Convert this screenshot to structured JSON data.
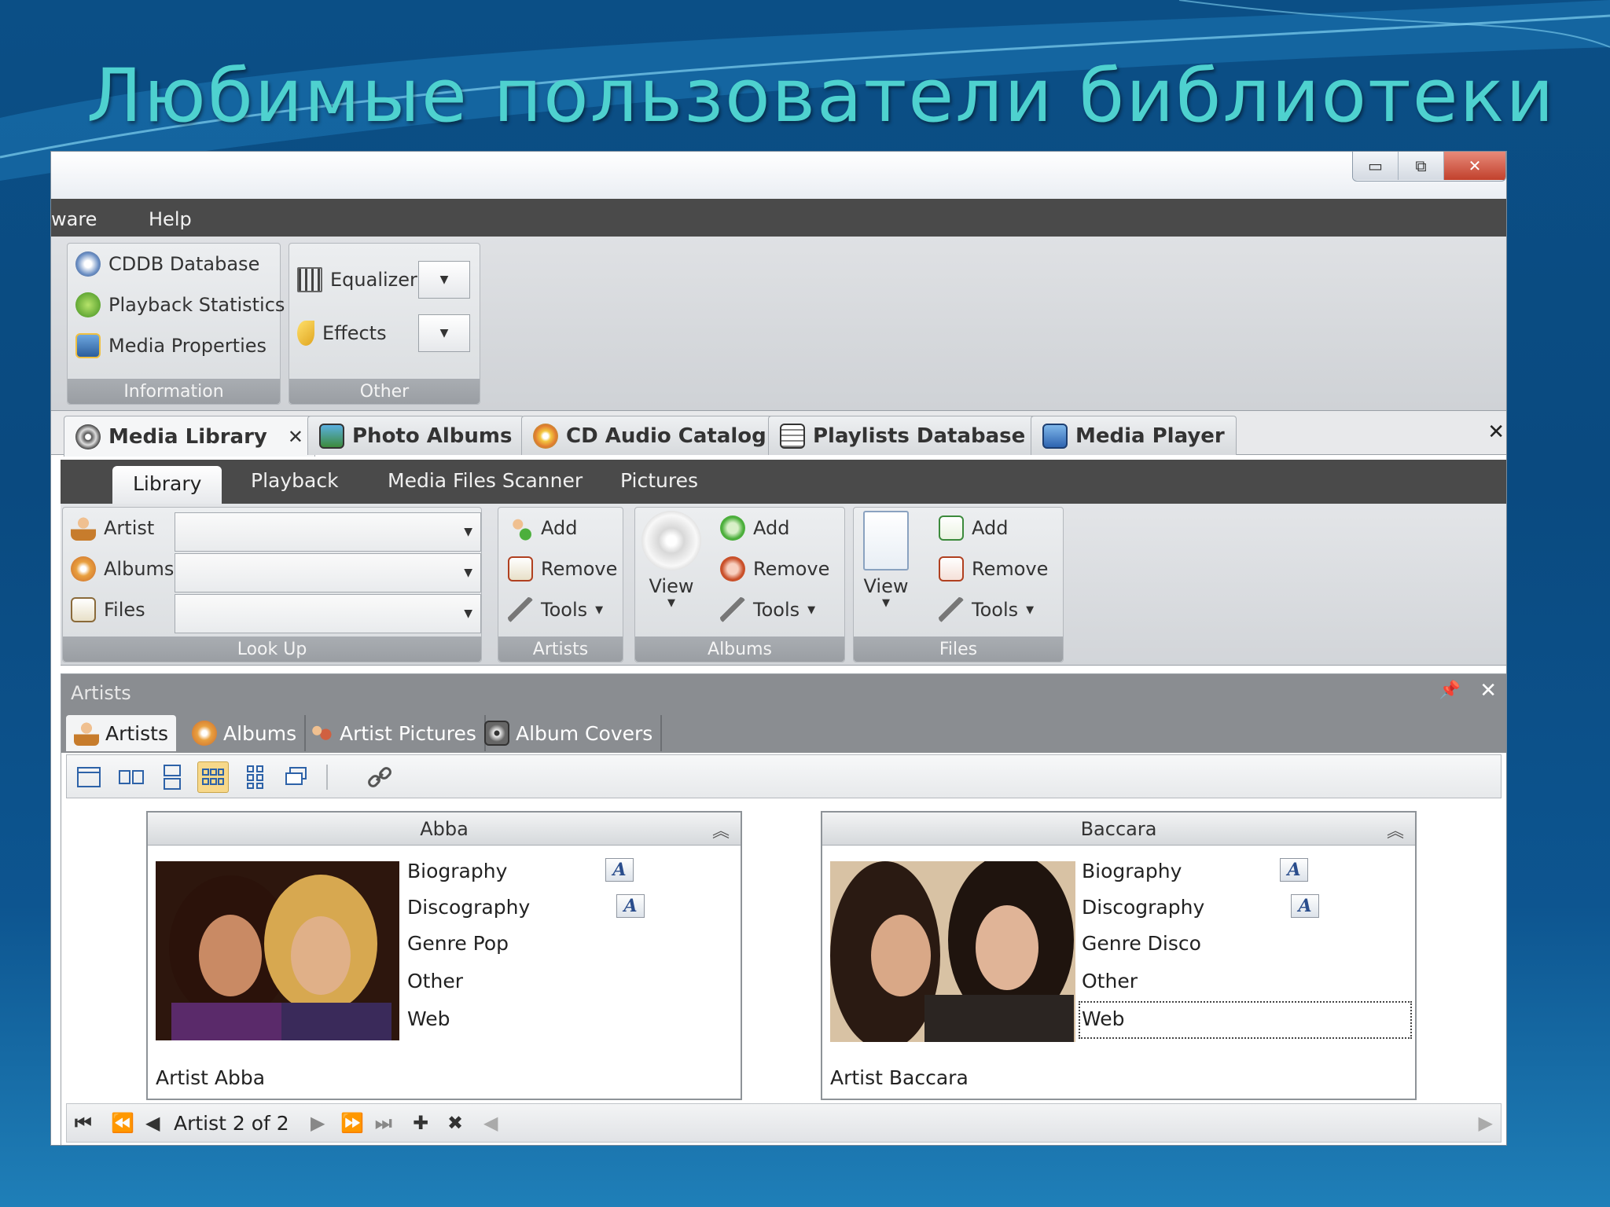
{
  "slide": {
    "title": "Любимые пользователи библиотеки"
  },
  "window": {
    "controls": {
      "minimize": "▭",
      "maximize": "⧉",
      "close": "✕"
    }
  },
  "menu": {
    "items": [
      "ware",
      "Help"
    ]
  },
  "ribbon_top": {
    "information": {
      "caption": "Information",
      "items": [
        "CDDB Database",
        "Playback Statistics",
        "Media Properties"
      ]
    },
    "other": {
      "caption": "Other",
      "items": [
        "Equalizer",
        "Effects"
      ]
    }
  },
  "doc_tabs": {
    "tabs": [
      "Media Library",
      "Photo Albums",
      "CD Audio Catalog",
      "Playlists Database",
      "Media Player"
    ],
    "active_close": "✕",
    "close_all": "✕"
  },
  "inner_tabs": [
    "Library",
    "Playback",
    "Media Files Scanner",
    "Pictures"
  ],
  "ribbon_lib": {
    "lookup": {
      "caption": "Look Up",
      "labels": [
        "Artist",
        "Albums",
        "Files"
      ]
    },
    "artists": {
      "caption": "Artists",
      "items": [
        "Add",
        "Remove",
        "Tools"
      ]
    },
    "albums": {
      "caption": "Albums",
      "view": "View",
      "items": [
        "Add",
        "Remove",
        "Tools"
      ]
    },
    "files": {
      "caption": "Files",
      "view": "View",
      "items": [
        "Add",
        "Remove",
        "Tools"
      ]
    }
  },
  "artists_panel": {
    "title": "Artists",
    "sub_tabs": [
      "Artists",
      "Albums",
      "Artist Pictures",
      "Album Covers"
    ],
    "cards": [
      {
        "name": "Abba",
        "fields": [
          "Biography",
          "Discography",
          "Genre  Pop",
          "Other",
          "Web"
        ],
        "footer": "Artist  Abba"
      },
      {
        "name": "Baccara",
        "fields": [
          "Biography",
          "Discography",
          "Genre  Disco",
          "Other",
          "Web"
        ],
        "footer": "Artist  Baccara"
      }
    ],
    "navigator": {
      "status": "Artist 2 of 2"
    }
  },
  "colors": {
    "title": "#4ed1cf",
    "menubar": "#4a4a4a",
    "accent": "#f7d88a"
  },
  "icons": [
    "cddb-icon",
    "stats-icon",
    "media-properties-icon",
    "equalizer-icon",
    "effects-icon",
    "film-reel-icon",
    "photo-icon",
    "cd-icon",
    "playlist-icon",
    "player-icon",
    "artist-icon",
    "album-icon",
    "files-icon",
    "add-icon",
    "remove-icon",
    "tools-icon",
    "note-icon"
  ]
}
